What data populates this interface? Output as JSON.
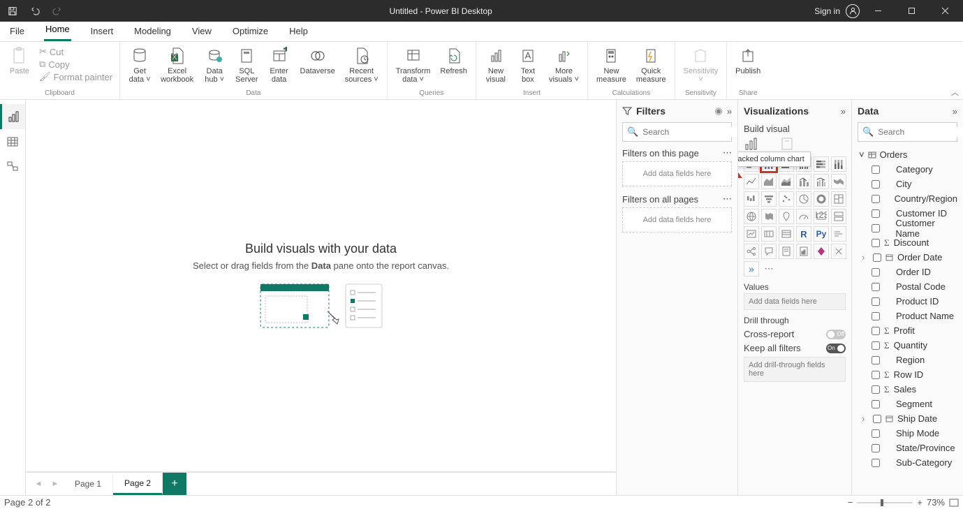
{
  "titlebar": {
    "title": "Untitled - Power BI Desktop",
    "signin": "Sign in"
  },
  "ribbon_tabs": [
    "File",
    "Home",
    "Insert",
    "Modeling",
    "View",
    "Optimize",
    "Help"
  ],
  "active_ribbon_tab": "Home",
  "ribbon": {
    "clipboard": {
      "paste": "Paste",
      "cut": "Cut",
      "copy": "Copy",
      "format_painter": "Format painter",
      "group": "Clipboard"
    },
    "data": {
      "get_data": "Get\ndata ˅",
      "excel": "Excel\nworkbook",
      "hub": "Data\nhub ˅",
      "sql": "SQL\nServer",
      "enter": "Enter\ndata",
      "dataverse": "Dataverse",
      "recent": "Recent\nsources ˅",
      "group": "Data"
    },
    "queries": {
      "transform": "Transform\ndata ˅",
      "refresh": "Refresh",
      "group": "Queries"
    },
    "insert": {
      "new_visual": "New\nvisual",
      "text_box": "Text\nbox",
      "more": "More\nvisuals ˅",
      "group": "Insert"
    },
    "calc": {
      "new_measure": "New\nmeasure",
      "quick": "Quick\nmeasure",
      "group": "Calculations"
    },
    "sensitivity": {
      "label": "Sensitivity\n˅",
      "group": "Sensitivity"
    },
    "share": {
      "publish": "Publish",
      "group": "Share"
    }
  },
  "canvas": {
    "title": "Build visuals with your data",
    "subtitle_pre": "Select or drag fields from the ",
    "subtitle_bold": "Data",
    "subtitle_post": " pane onto the report canvas."
  },
  "pages": {
    "tabs": [
      "Page 1",
      "Page 2"
    ],
    "active": "Page 2"
  },
  "filters": {
    "title": "Filters",
    "search_ph": "Search",
    "section1": "Filters on this page",
    "drop": "Add data fields here",
    "section2": "Filters on all pages"
  },
  "viz": {
    "title": "Visualizations",
    "build": "Build visual",
    "tooltip": "Stacked column chart",
    "values": "Values",
    "values_drop": "Add data fields here",
    "drill": "Drill through",
    "cross": "Cross-report",
    "cross_state": "Off",
    "keep": "Keep all filters",
    "keep_state": "On",
    "drill_drop": "Add drill-through fields here"
  },
  "data_pane": {
    "title": "Data",
    "search_ph": "Search",
    "table": "Orders",
    "fields": [
      {
        "name": "Category",
        "type": "text"
      },
      {
        "name": "City",
        "type": "text"
      },
      {
        "name": "Country/Region",
        "type": "text"
      },
      {
        "name": "Customer ID",
        "type": "text"
      },
      {
        "name": "Customer Name",
        "type": "text"
      },
      {
        "name": "Discount",
        "type": "sum"
      },
      {
        "name": "Order Date",
        "type": "date"
      },
      {
        "name": "Order ID",
        "type": "text"
      },
      {
        "name": "Postal Code",
        "type": "text"
      },
      {
        "name": "Product ID",
        "type": "text"
      },
      {
        "name": "Product Name",
        "type": "text"
      },
      {
        "name": "Profit",
        "type": "sum"
      },
      {
        "name": "Quantity",
        "type": "sum"
      },
      {
        "name": "Region",
        "type": "text"
      },
      {
        "name": "Row ID",
        "type": "sum"
      },
      {
        "name": "Sales",
        "type": "sum"
      },
      {
        "name": "Segment",
        "type": "text"
      },
      {
        "name": "Ship Date",
        "type": "date"
      },
      {
        "name": "Ship Mode",
        "type": "text"
      },
      {
        "name": "State/Province",
        "type": "text"
      },
      {
        "name": "Sub-Category",
        "type": "text"
      }
    ]
  },
  "status": {
    "left": "Page 2 of 2",
    "zoom": "73%"
  }
}
